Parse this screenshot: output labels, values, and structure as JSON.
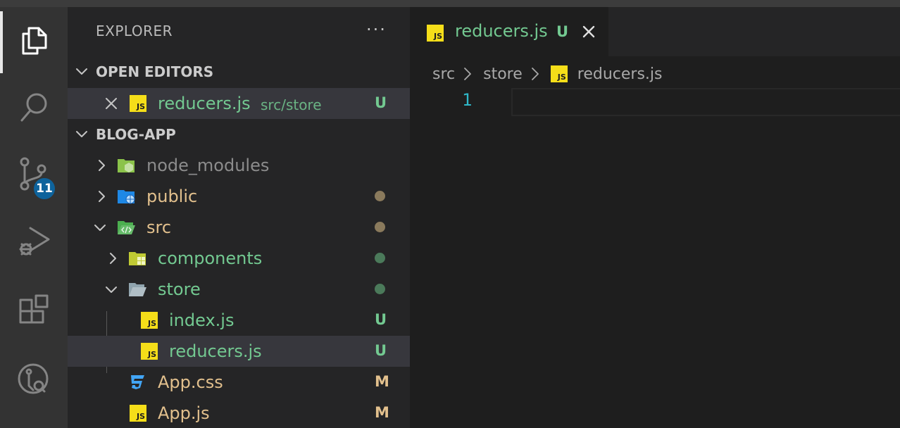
{
  "sidebar": {
    "title": "EXPLORER",
    "more": "···",
    "sections": {
      "open_editors": "OPEN EDITORS",
      "project": "BLOG-APP"
    },
    "open_editors": [
      {
        "name": "reducers.js",
        "path": "src/store",
        "status": "U"
      }
    ],
    "tree": {
      "node_modules": "node_modules",
      "public": "public",
      "src": "src",
      "components": "components",
      "store": "store",
      "index": {
        "name": "index.js",
        "status": "U"
      },
      "reducers": {
        "name": "reducers.js",
        "status": "U"
      },
      "app_css": {
        "name": "App.css",
        "status": "M"
      },
      "app_js": {
        "name": "App.js",
        "status": "M"
      }
    }
  },
  "activity": {
    "scm_badge": "11"
  },
  "editor": {
    "tab": {
      "label": "reducers.js",
      "status": "U"
    },
    "breadcrumb": [
      "src",
      "store",
      "reducers.js"
    ],
    "line_numbers": [
      "1"
    ]
  },
  "icons": {
    "js_label": "JS"
  },
  "colors": {
    "untracked": "#73c991",
    "modified": "#e2c08d",
    "badge": "#0e639c",
    "js_icon": "#f5de19"
  }
}
